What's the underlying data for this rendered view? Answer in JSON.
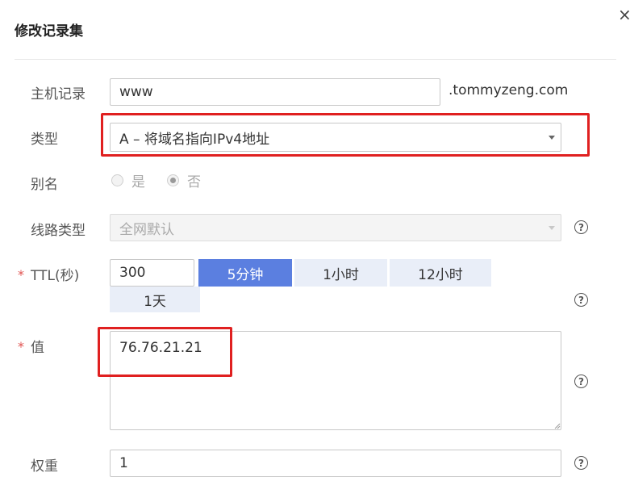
{
  "dialog": {
    "title": "修改记录集",
    "close_icon": "×"
  },
  "host": {
    "label": "主机记录",
    "value": "www",
    "suffix": ".tommyzeng.com"
  },
  "type": {
    "label": "类型",
    "selected": "A – 将域名指向IPv4地址"
  },
  "alias": {
    "label": "别名",
    "options": [
      "是",
      "否"
    ],
    "selected": "否"
  },
  "line": {
    "label": "线路类型",
    "selected": "全网默认"
  },
  "ttl": {
    "required_mark": "*",
    "label": "TTL(秒)",
    "value": "300",
    "presets": [
      "5分钟",
      "1小时",
      "12小时",
      "1天"
    ],
    "active_preset": "5分钟"
  },
  "value": {
    "required_mark": "*",
    "label": "值",
    "text": "76.76.21.21"
  },
  "weight": {
    "label": "权重",
    "value": "1"
  },
  "help_glyph": "?",
  "colors": {
    "accent": "#5b7fe0",
    "highlight": "#e02020",
    "required": "#e0524f"
  }
}
